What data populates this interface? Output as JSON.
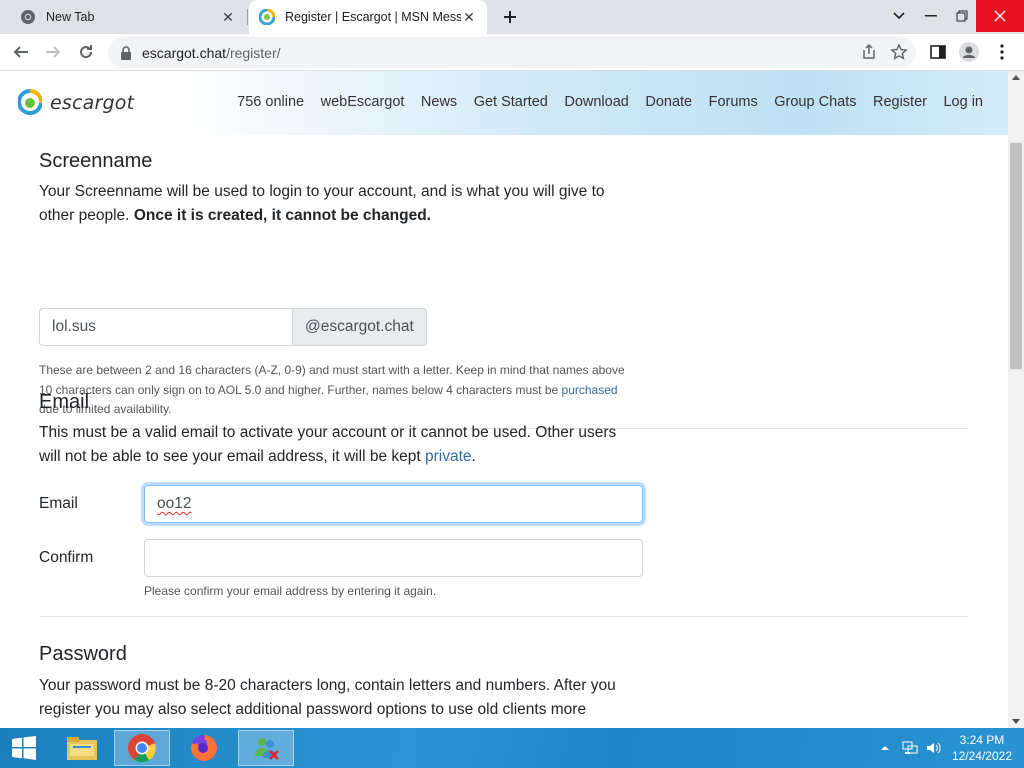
{
  "browser": {
    "tabs": [
      {
        "title": "New Tab"
      },
      {
        "title": "Register | Escargot | MSN Messenger"
      }
    ],
    "url_domain": "escargot.chat",
    "url_path": "/register/"
  },
  "site": {
    "logo_text": "escargot",
    "nav": [
      "756 online",
      "webEscargot",
      "News",
      "Get Started",
      "Download",
      "Donate",
      "Forums",
      "Group Chats",
      "Register",
      "Log in"
    ]
  },
  "screenname": {
    "heading": "Screenname",
    "desc_part1": "Your Screenname will be used to login to your account, and is what you will give to other people.",
    "desc_bold": "Once it is created, it cannot be changed.",
    "input_value": "lol.sus",
    "addon": "@escargot.chat",
    "help_part1": "These are between 2 and 16 characters (A-Z, 0-9) and must start with a letter. Keep in mind that names above 10 characters can only sign on to AOL 5.0 and higher. Further, names below 4 characters must be",
    "help_link": "purchased",
    "help_part2": "due to limited availability."
  },
  "email": {
    "heading": "Email",
    "desc_part1": "This must be a valid email to activate your account or it cannot be used. Other users will not be able to see your email address, it will be kept",
    "desc_link": "private",
    "desc_end": ".",
    "label_email": "Email",
    "email_value": "oo12",
    "label_confirm": "Confirm",
    "confirm_value": "",
    "confirm_help": "Please confirm your email address by entering it again."
  },
  "password": {
    "heading": "Password",
    "desc": "Your password must be 8-20 characters long, contain letters and numbers. After you register you may also select additional password options to use old clients more"
  },
  "taskbar": {
    "time": "3:24 PM",
    "date": "12/24/2022"
  },
  "colors": {
    "link": "#2c6ca3",
    "taskbar": "#1e86c7",
    "focus": "#80bdff"
  }
}
